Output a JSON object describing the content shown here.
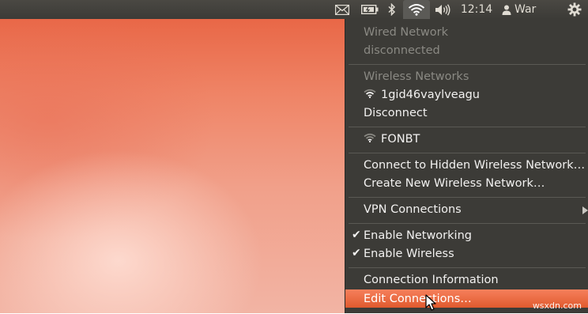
{
  "panel": {
    "time": "12:14",
    "user": "War"
  },
  "menu": {
    "wired_header": "Wired Network",
    "wired_status": "disconnected",
    "wireless_header": "Wireless Networks",
    "connected_network": "1gid46vaylveagu",
    "disconnect": "Disconnect",
    "other_network": "FONBT",
    "connect_hidden": "Connect to Hidden Wireless Network…",
    "create_new": "Create New Wireless Network…",
    "vpn": "VPN Connections",
    "enable_networking": "Enable Networking",
    "enable_wireless": "Enable Wireless",
    "connection_info": "Connection Information",
    "edit_connections": "Edit Connections…"
  },
  "watermark": "wsxdn.com",
  "colors": {
    "panel_bg": "#3c3b37",
    "menu_bg": "#3c3b37",
    "highlight": "#e9683f",
    "disabled_text": "#8a8983"
  }
}
